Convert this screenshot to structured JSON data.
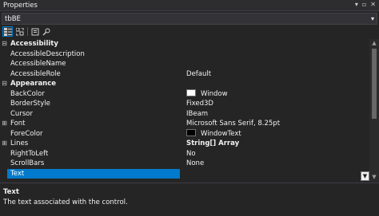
{
  "window": {
    "title": "Properties",
    "icons": [
      "▾",
      "▫",
      "✕"
    ]
  },
  "object_selector": {
    "value": "tbBE",
    "arrow": "▾"
  },
  "toolbar": {
    "icons": [
      "categorized-icon",
      "alphabetical-icon",
      "properties-icon",
      "events-icon"
    ]
  },
  "grid": {
    "rows": [
      {
        "type": "category",
        "expander": "⊟",
        "name": "Accessibility",
        "value": ""
      },
      {
        "type": "prop",
        "name": "AccessibleDescription",
        "value": ""
      },
      {
        "type": "prop",
        "name": "AccessibleName",
        "value": ""
      },
      {
        "type": "prop",
        "name": "AccessibleRole",
        "value": "Default"
      },
      {
        "type": "category",
        "expander": "⊟",
        "name": "Appearance",
        "value": ""
      },
      {
        "type": "prop",
        "name": "BackColor",
        "value": "Window",
        "swatch": "#ffffff"
      },
      {
        "type": "prop",
        "name": "BorderStyle",
        "value": "Fixed3D"
      },
      {
        "type": "prop",
        "name": "Cursor",
        "value": "IBeam"
      },
      {
        "type": "prop",
        "expander": "⊞",
        "name": "Font",
        "value": "Microsoft Sans Serif, 8.25pt"
      },
      {
        "type": "prop",
        "name": "ForeColor",
        "value": "WindowText",
        "swatch": "#000000"
      },
      {
        "type": "prop",
        "expander": "⊞",
        "name": "Lines",
        "value": "String[] Array",
        "bold_value": true
      },
      {
        "type": "prop",
        "name": "RightToLeft",
        "value": "No"
      },
      {
        "type": "prop",
        "name": "ScrollBars",
        "value": "None"
      },
      {
        "type": "prop",
        "name": "Text",
        "value": "",
        "selected": true
      }
    ]
  },
  "scrollbar": {
    "up": "▲",
    "down": "▼"
  },
  "dropdown_button": {
    "glyph": "▼"
  },
  "description": {
    "title": "Text",
    "text": "The text associated with the control."
  },
  "colors": {
    "accent": "#007acc",
    "background": "#252526",
    "selector_bg": "#333337"
  }
}
